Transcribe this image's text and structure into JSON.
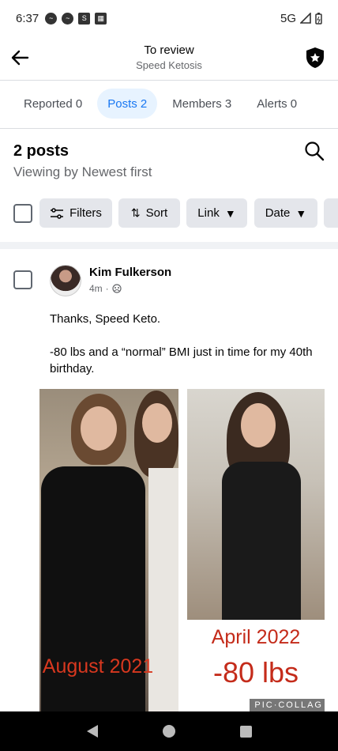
{
  "status_bar": {
    "time": "6:37",
    "network": "5G"
  },
  "header": {
    "title": "To review",
    "subtitle": "Speed Ketosis"
  },
  "tabs": [
    {
      "label": "Reported 0",
      "active": false
    },
    {
      "label": "Posts 2",
      "active": true
    },
    {
      "label": "Members 3",
      "active": false
    },
    {
      "label": "Alerts 0",
      "active": false
    }
  ],
  "summary": {
    "count_label": "2 posts",
    "sort_label": "Viewing by Newest first"
  },
  "filters": {
    "filters_label": "Filters",
    "sort_label": "Sort",
    "link_label": "Link",
    "date_label": "Date"
  },
  "post": {
    "author": "Kim Fulkerson",
    "time": "4m",
    "text_line1": "Thanks, Speed Keto.",
    "text_line2": "-80 lbs and a “normal” BMI just in time for my 40th birthday.",
    "image": {
      "caption_left": "August 2021",
      "caption_right_1": "April 2022",
      "caption_right_2": "-80 lbs",
      "watermark": "PIC·COLLAG"
    }
  },
  "colors": {
    "accent": "#1877f2",
    "tab_active_bg": "#e7f3ff",
    "chip_bg": "#e4e6eb",
    "caption_red": "#d8381f"
  }
}
